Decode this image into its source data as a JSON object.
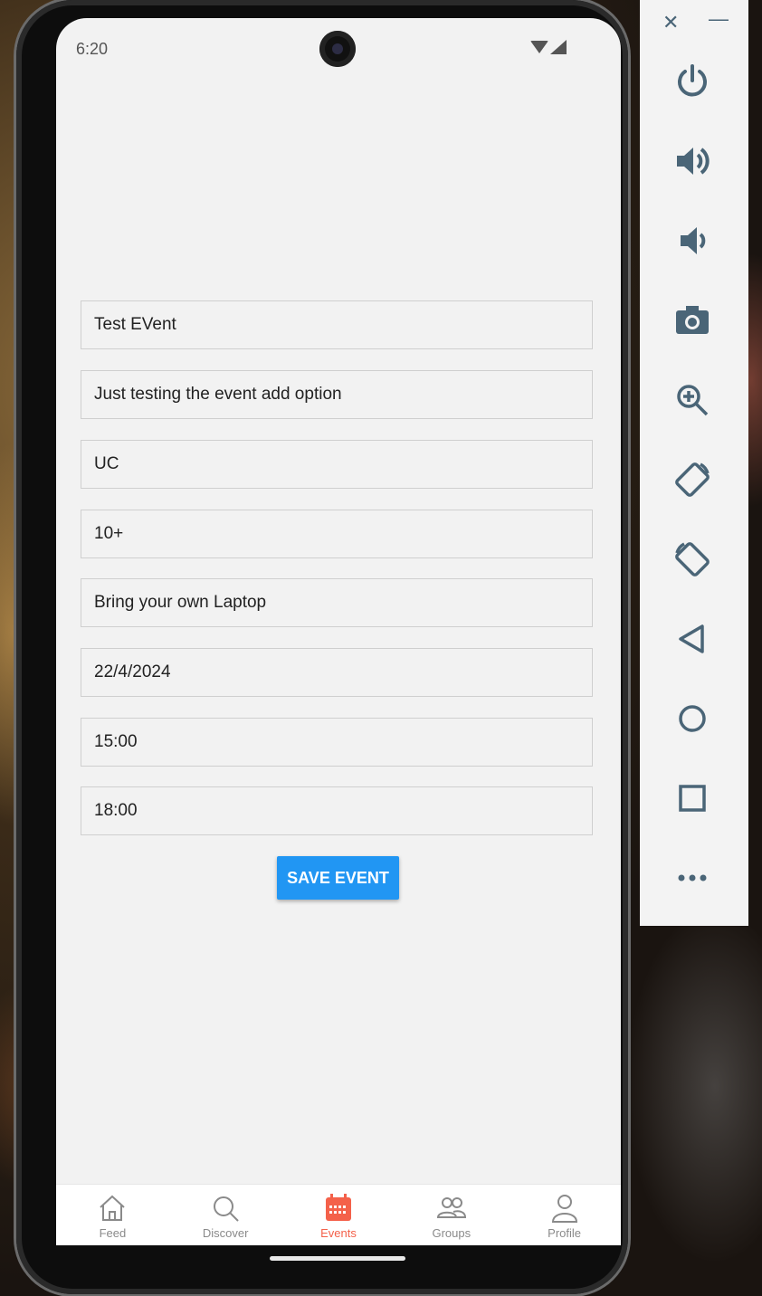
{
  "status_bar": {
    "time": "6:20"
  },
  "form": {
    "title_value": "Test EVent",
    "description_value": "Just testing the event add option",
    "location_value": "UC",
    "age_value": "10+",
    "requirements_value": "Bring your own Laptop",
    "date_value": "22/4/2024",
    "start_time_value": "15:00",
    "end_time_value": "18:00",
    "save_label": "SAVE EVENT"
  },
  "bottom_nav": {
    "items": [
      {
        "label": "Feed",
        "icon": "home-icon",
        "active": false
      },
      {
        "label": "Discover",
        "icon": "search-icon",
        "active": false
      },
      {
        "label": "Events",
        "icon": "calendar-icon",
        "active": true
      },
      {
        "label": "Groups",
        "icon": "people-icon",
        "active": false
      },
      {
        "label": "Profile",
        "icon": "person-icon",
        "active": false
      }
    ]
  },
  "emulator_controls": [
    "close-icon",
    "minimize-icon",
    "power-icon",
    "volume-up-icon",
    "volume-down-icon",
    "camera-icon",
    "zoom-icon",
    "rotate-left-icon",
    "rotate-right-icon",
    "back-icon",
    "home-circle-icon",
    "overview-square-icon",
    "more-icon"
  ],
  "colors": {
    "accent": "#2196f3",
    "active_tab": "#f4614a",
    "icon_gray": "#4a6577"
  }
}
